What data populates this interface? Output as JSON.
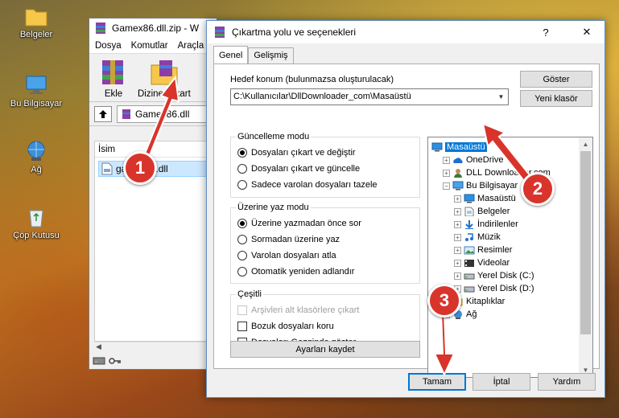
{
  "desktop": {
    "icons": [
      {
        "label": "Belgeler",
        "icon": "folder-icon"
      },
      {
        "label": "Bu Bilgisayar",
        "icon": "computer-icon"
      },
      {
        "label": "Ağ",
        "icon": "network-icon"
      },
      {
        "label": "Çöp Kutusu",
        "icon": "recycle-bin-icon"
      }
    ]
  },
  "rar_window": {
    "title": "Gamex86.dll.zip - W",
    "menu": [
      "Dosya",
      "Komutlar",
      "Araçla"
    ],
    "tools": [
      {
        "label": "Ekle"
      },
      {
        "label": "Dizine Çıkart"
      }
    ],
    "path": "Gamex86.dll",
    "column_header": "İsim",
    "row": "gamex86.dll"
  },
  "dialog": {
    "title": "Çıkartma yolu ve seçenekleri",
    "help": "?",
    "close": "✕",
    "tabs": [
      "Genel",
      "Gelişmiş"
    ],
    "target_label": "Hedef konum (bulunmazsa oluşturulacak)",
    "target_value": "C:\\Kullanıcılar\\DllDownloader_com\\Masaüstü",
    "show_button": "Göster",
    "new_folder_button": "Yeni klasör",
    "update_mode": {
      "title": "Güncelleme modu",
      "options": [
        "Dosyaları çıkart ve değiştir",
        "Dosyaları çıkart ve güncelle",
        "Sadece varolan dosyaları tazele"
      ],
      "selected": 0
    },
    "overwrite_mode": {
      "title": "Üzerine yaz modu",
      "options": [
        "Üzerine yazmadan önce sor",
        "Sormadan üzerine yaz",
        "Varolan dosyaları atla",
        "Otomatik yeniden adlandır"
      ],
      "selected": 0
    },
    "misc": {
      "title": "Çeşitli",
      "options": [
        "Arşivleri alt klasörlere çıkart",
        "Bozuk dosyaları koru",
        "Dosyaları Gezginde göster"
      ],
      "disabled_index": 0
    },
    "save_settings": "Ayarları kaydet",
    "tree": [
      {
        "label": "Masaüstü",
        "icon": "desktop-icon",
        "level": 0,
        "expander": "",
        "selected": true
      },
      {
        "label": "OneDrive",
        "icon": "onedrive-icon",
        "level": 1,
        "expander": "+"
      },
      {
        "label": "DLL Downloader.com",
        "icon": "user-icon",
        "level": 1,
        "expander": "+"
      },
      {
        "label": "Bu Bilgisayar",
        "icon": "computer-icon",
        "level": 1,
        "expander": "−"
      },
      {
        "label": "Masaüstü",
        "icon": "desktop-icon",
        "level": 2,
        "expander": "+"
      },
      {
        "label": "Belgeler",
        "icon": "documents-icon",
        "level": 2,
        "expander": "+"
      },
      {
        "label": "İndirilenler",
        "icon": "download-icon",
        "level": 2,
        "expander": "+"
      },
      {
        "label": "Müzik",
        "icon": "music-icon",
        "level": 2,
        "expander": "+"
      },
      {
        "label": "Resimler",
        "icon": "pictures-icon",
        "level": 2,
        "expander": "+"
      },
      {
        "label": "Videolar",
        "icon": "videos-icon",
        "level": 2,
        "expander": "+"
      },
      {
        "label": "Yerel Disk (C:)",
        "icon": "drive-icon",
        "level": 2,
        "expander": "+"
      },
      {
        "label": "Yerel Disk (D:)",
        "icon": "drive-icon",
        "level": 2,
        "expander": "+"
      },
      {
        "label": "Kitaplıklar",
        "icon": "libraries-icon",
        "level": 1,
        "expander": "+"
      },
      {
        "label": "Ağ",
        "icon": "network-icon",
        "level": 1,
        "expander": "+"
      }
    ],
    "ok_button": "Tamam",
    "cancel_button": "İptal",
    "help_button": "Yardım"
  },
  "annotations": {
    "step1": "1",
    "step2": "2",
    "step3": "3",
    "color": "#d9342b"
  }
}
